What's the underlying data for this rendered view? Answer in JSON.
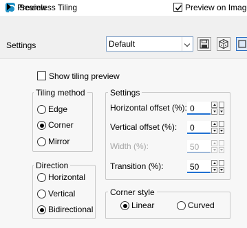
{
  "window": {
    "title": "Seamless Tiling"
  },
  "toolbar": {
    "preview_label": "Preview",
    "preview_on_image_label": "Preview on Image",
    "preview_on_image_checked": true,
    "settings_label": "Settings",
    "settings_value": "Default",
    "icons": [
      "save-icon",
      "dice-icon",
      "settings-icon"
    ]
  },
  "options": {
    "show_tiling_preview_label": "Show tiling preview",
    "show_tiling_preview_checked": false
  },
  "tiling_method": {
    "title": "Tiling method",
    "selected": "Corner",
    "options": [
      "Edge",
      "Corner",
      "Mirror"
    ]
  },
  "direction": {
    "title": "Direction",
    "selected": "Bidirectional",
    "options": [
      "Horizontal",
      "Vertical",
      "Bidirectional"
    ]
  },
  "settings": {
    "title": "Settings",
    "horizontal_offset": {
      "label": "Horizontal offset (%):",
      "value": "0"
    },
    "vertical_offset": {
      "label": "Vertical offset (%):",
      "value": "0"
    },
    "width": {
      "label": "Width (%):",
      "value": "50",
      "disabled": true
    },
    "transition": {
      "label": "Transition (%):",
      "value": "50"
    }
  },
  "corner_style": {
    "title": "Corner style",
    "selected": "Linear",
    "options": [
      "Linear",
      "Curved"
    ]
  },
  "colors": {
    "accent": "#1f6fd1",
    "app_icon": "#1f8fc4"
  }
}
